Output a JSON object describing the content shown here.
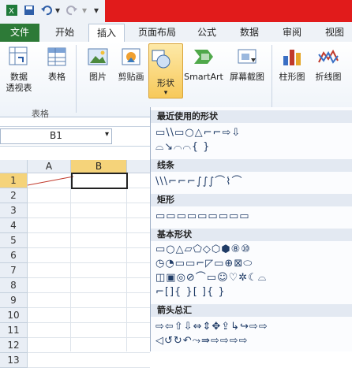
{
  "quick_access": {
    "save_icon": "save-icon",
    "undo_icon": "undo-icon",
    "redo_icon": "redo-icon"
  },
  "tabs": [
    {
      "label": "文件",
      "active": false
    },
    {
      "label": "开始",
      "active": false
    },
    {
      "label": "插入",
      "active": true
    },
    {
      "label": "页面布局",
      "active": false
    },
    {
      "label": "公式",
      "active": false
    },
    {
      "label": "数据",
      "active": false
    },
    {
      "label": "审阅",
      "active": false
    },
    {
      "label": "视图",
      "active": false
    }
  ],
  "ribbon": {
    "group_tables_label": "表格",
    "buttons": [
      {
        "label": "数据\n透视表",
        "icon": "pivot-table-icon"
      },
      {
        "label": "表格",
        "icon": "table-icon"
      },
      {
        "label": "图片",
        "icon": "picture-icon"
      },
      {
        "label": "剪贴画",
        "icon": "clipart-icon"
      },
      {
        "label": "形状",
        "icon": "shapes-icon"
      },
      {
        "label": "SmartArt",
        "icon": "smartart-icon"
      },
      {
        "label": "屏幕截图",
        "icon": "screenshot-icon"
      },
      {
        "label": "柱形图",
        "icon": "column-chart-icon"
      },
      {
        "label": "折线图",
        "icon": "line-chart-icon"
      }
    ],
    "pivot_label_1": "数据",
    "pivot_label_2": "透视表",
    "table_label": "表格",
    "picture_label": "图片",
    "clipart_label": "剪贴画",
    "shapes_label": "形状",
    "smartart_label": "SmartArt",
    "screenshot_label": "屏幕截图",
    "column_label": "柱形图",
    "line_label": "折线图"
  },
  "formula_bar": {
    "name_box": "B1"
  },
  "grid": {
    "columns": [
      "A",
      "B"
    ],
    "rows": [
      "1",
      "2",
      "3",
      "4",
      "5",
      "6",
      "7",
      "8",
      "9",
      "10",
      "11",
      "12",
      "13"
    ],
    "selected_cell": "B1"
  },
  "shapes_menu": {
    "recent_title": "最近使用的形状",
    "lines_title": "线条",
    "rect_title": "矩形",
    "basic_title": "基本形状",
    "arrows_title": "箭头总汇",
    "recent_row1": "▭\\\\▭○△⌐⌐⇨⇩",
    "recent_row2": "⌓↘⌒⌒{ }",
    "lines_row": "\\\\\\⌐⌐⌐∫∫∫⌒⌇⌒",
    "rect_row": "▭▭▭▭▭▭▭▭▭",
    "basic_row1": "▭○△▱⬠◇⬡⬢⑧⑩",
    "basic_row2": "◷◔▭▭⌐◸▭⊕⊠⬭",
    "basic_row3": "◫▣◎⊘⌒▭☺♡✲☾⌓",
    "basic_row4": "⌐[]{ }[ ]{ }",
    "arrows_row1": "⇨⇦⇧⇩⇔⇕✥⇪↳↪⇨⇨",
    "arrows_row2": "◁↺↻↶⤳⇛⇨⇨⇨⇨"
  },
  "colors": {
    "title_red": "#e11b1b",
    "file_tab": "#2d7a37",
    "selected_tool": "#f7c95a"
  }
}
